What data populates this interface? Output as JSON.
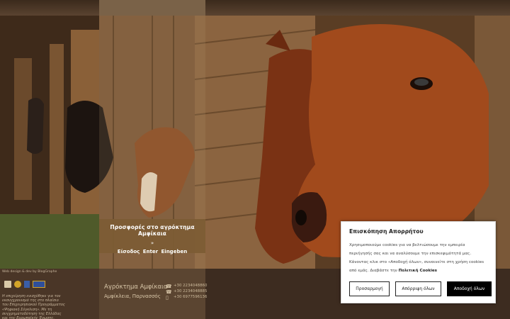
{
  "offer": {
    "title": "Προσφορές στο αγρόκτημα Αμφίκαια",
    "arrow": "»",
    "enter": "Είσοδος Enter Eingeben"
  },
  "footer": {
    "credit": "Web design & dev by BlogGraphe",
    "disclaimer": "Η επιχείρηση ενισχύθηκε για τον εκσυγχρονισμό της στο πλαίσιο του Επιχειρησιακού Προγράμματος «Ψηφιακή Σύγκλιση». Με τη συγχρηματοδότηση της Ελλάδας και της Ευρωπαϊκής Ένωσης.",
    "farm_name": "Αγρόκτημα Αμφίκαια",
    "location": "Αμφίκλεια, Παρνασσός",
    "phones": [
      "+30 2234048860",
      "+30 2234048885",
      "+30 6977596136"
    ]
  },
  "cookie": {
    "title": "Επισκόπηση Απορρήτου",
    "text": "Χρησιμοποιούμε cookies για να βελτιώσουμε την εμπειρία περιήγησής σας και να αναλύσουμε την επισκεψιμότητά μας. Κάνοντας κλικ στο «Αποδοχή όλων», συναινείτε στη χρήση cookies από εμάς. Διαβάστε την",
    "policy_link": "Πολιτική Cookies",
    "btn_customize": "Προσαρμογή",
    "btn_reject": "Απόρριψη όλων",
    "btn_accept": "Αποδοχή όλων"
  }
}
